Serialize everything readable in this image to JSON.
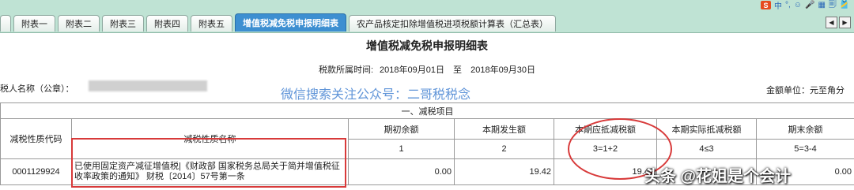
{
  "tabs": [
    "附表一",
    "附表二",
    "附表三",
    "附表四",
    "附表五",
    "增值税减免税申报明细表",
    "农产品核定扣除增值税进项税额计算表（汇总表）"
  ],
  "tray": {
    "logo": "S",
    "items": [
      "中",
      "°,",
      "☺",
      "🎤",
      "▦",
      "🗐",
      "🎽",
      "⋮"
    ]
  },
  "title": "增值税减免税申报明细表",
  "period": {
    "label": "税款所属时间:",
    "start": "2018年09月01日",
    "to": "至",
    "end": "2018年09月30日"
  },
  "taxpayer_label": "税人名称（公章）：",
  "watermark": "微信搜索关注公众号：二哥税税念",
  "unit": "金额单位：元至角分",
  "table": {
    "section": "一、减税项目",
    "headers": {
      "code": "减税性质代码",
      "name": "减税性质名称",
      "opening": "期初余额",
      "current": "本期发生额",
      "deductible": "本期应抵减税额",
      "actual": "本期实际抵减税额",
      "closing": "期末余额"
    },
    "formulas": {
      "opening": "1",
      "current": "2",
      "deductible": "3=1+2",
      "actual": "4≤3",
      "closing": "5=3-4"
    },
    "row": {
      "code": "0001129924",
      "name": "已使用固定资产减征增值税|《财政部 国家税务总局关于简并增值税征收率政策的通知》 财税〔2014〕57号第一条",
      "opening": "0.00",
      "current": "19.42",
      "deductible": "19.42",
      "actual": "",
      "closing": "0.00"
    }
  },
  "overlay_text": "头条 @花姐是个会计"
}
